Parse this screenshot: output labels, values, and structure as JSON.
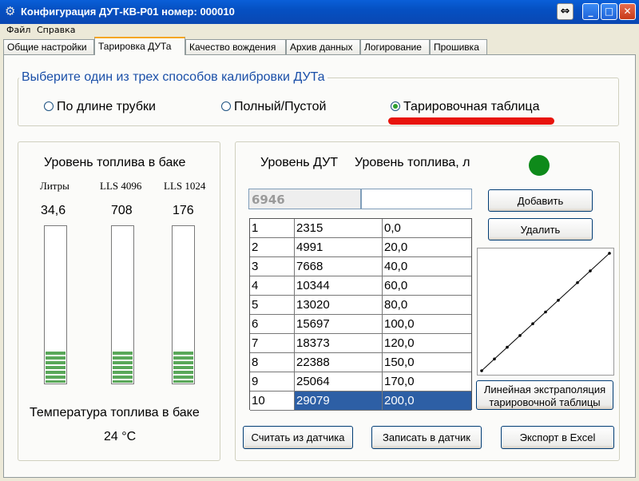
{
  "window": {
    "title": "Конфигурация ДУТ-КВ-Р01 номер: 000010",
    "buttons": {
      "extra": "⇔",
      "minimize": "_",
      "maximize": "□",
      "close": "✕"
    }
  },
  "menu": [
    "Файл",
    "Справка"
  ],
  "tabs": [
    {
      "label": "Общие настройки",
      "active": false
    },
    {
      "label": "Тарировка ДУТа",
      "active": true
    },
    {
      "label": "Качество вождения",
      "active": false
    },
    {
      "label": "Архив данных",
      "active": false
    },
    {
      "label": "Логирование",
      "active": false
    },
    {
      "label": "Прошивка",
      "active": false
    }
  ],
  "calibration": {
    "legend": "Выберите один из трех способов калибровки ДУТа",
    "options": [
      {
        "label": "По длине трубки",
        "checked": false
      },
      {
        "label": "Полный/Пустой",
        "checked": false
      },
      {
        "label": "Тарировочная таблица",
        "checked": true
      }
    ]
  },
  "tank": {
    "title": "Уровень топлива в баке",
    "gauges": [
      {
        "label": "Литры",
        "value": "34,6",
        "fill_fraction": 0.2
      },
      {
        "label": "LLS 4096",
        "value": "708",
        "fill_fraction": 0.2
      },
      {
        "label": "LLS 1024",
        "value": "176",
        "fill_fraction": 0.2
      }
    ],
    "temperature_title": "Температура топлива в баке",
    "temperature_value": "24 °C"
  },
  "table_panel": {
    "header_level": "Уровень ДУТ",
    "header_fuel": "Уровень топлива, л",
    "status_color": "#0e8a1a",
    "current_level": "6946",
    "current_fuel": "",
    "rows": [
      {
        "n": "1",
        "level": "2315",
        "fuel": "0,0"
      },
      {
        "n": "2",
        "level": "4991",
        "fuel": "20,0"
      },
      {
        "n": "3",
        "level": "7668",
        "fuel": "40,0"
      },
      {
        "n": "4",
        "level": "10344",
        "fuel": "60,0"
      },
      {
        "n": "5",
        "level": "13020",
        "fuel": "80,0"
      },
      {
        "n": "6",
        "level": "15697",
        "fuel": "100,0"
      },
      {
        "n": "7",
        "level": "18373",
        "fuel": "120,0"
      },
      {
        "n": "8",
        "level": "22388",
        "fuel": "150,0"
      },
      {
        "n": "9",
        "level": "25064",
        "fuel": "170,0"
      },
      {
        "n": "10",
        "level": "29079",
        "fuel": "200,0",
        "selected": true
      }
    ],
    "add_button": "Добавить",
    "delete_button": "Удалить",
    "extrapolation_button_line1": "Линейная экстраполяция",
    "extrapolation_button_line2": "тарировочной таблицы",
    "read_button": "Считать из датчика",
    "write_button": "Записать в датчик",
    "export_button": "Экспорт в Excel"
  },
  "colors": {
    "accent": "#1a4fa8",
    "selection": "#2d5fa5",
    "highlight": "#e8140c",
    "gauge_fill": "#5aa85a"
  }
}
